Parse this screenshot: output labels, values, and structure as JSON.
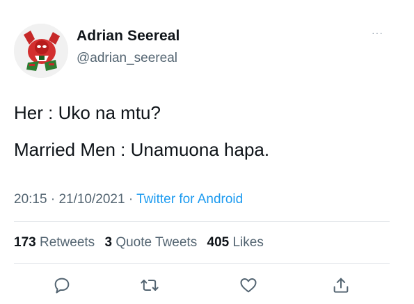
{
  "author": {
    "display_name": "Adrian Seereal",
    "handle": "@adrian_seereal",
    "avatar_icon": "deadpool-avatar"
  },
  "tweet": {
    "lines": [
      "Her : Uko na mtu?",
      "Married Men : Unamuona hapa."
    ]
  },
  "meta": {
    "time": "20:15",
    "separator": "·",
    "date": "21/10/2021",
    "source": "Twitter for Android"
  },
  "stats": {
    "retweets_count": "173",
    "retweets_label": "Retweets",
    "quote_count": "3",
    "quote_label": "Quote Tweets",
    "likes_count": "405",
    "likes_label": "Likes"
  },
  "actions": [
    "reply-icon",
    "retweet-icon",
    "like-icon",
    "share-icon"
  ],
  "colors": {
    "text": "#0f1419",
    "secondary": "#536471",
    "link": "#1d9bf0",
    "divider": "#e4e8eb"
  }
}
